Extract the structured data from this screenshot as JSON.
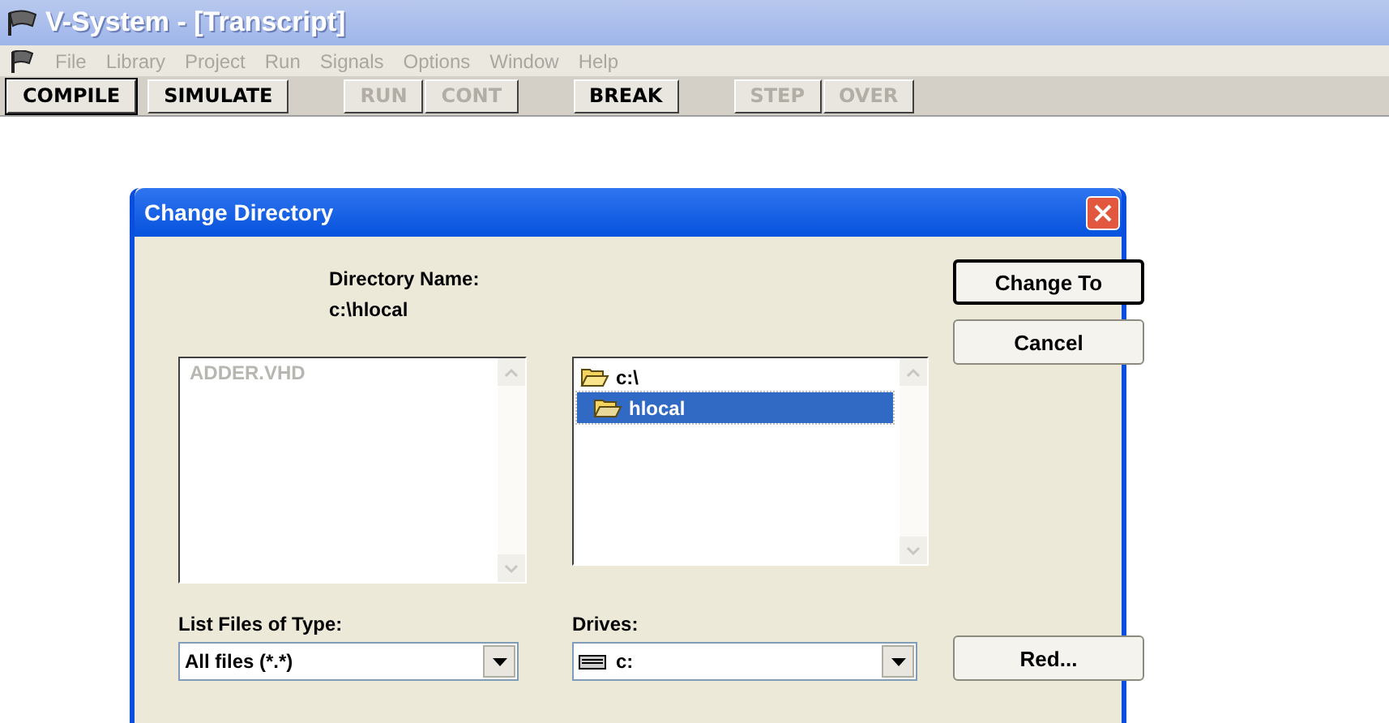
{
  "window": {
    "title": "V-System - [Transcript]"
  },
  "menu": [
    {
      "label": "File",
      "disabled": true
    },
    {
      "label": "Library",
      "disabled": true
    },
    {
      "label": "Project",
      "disabled": true
    },
    {
      "label": "Run",
      "disabled": true
    },
    {
      "label": "Signals",
      "disabled": true
    },
    {
      "label": "Options",
      "disabled": true
    },
    {
      "label": "Window",
      "disabled": true
    },
    {
      "label": "Help",
      "disabled": true
    }
  ],
  "toolbar": [
    [
      {
        "label": "COMPILE",
        "disabled": false,
        "pressed": true
      },
      {
        "label": "SIMULATE",
        "disabled": false,
        "pressed": false
      }
    ],
    [
      {
        "label": "RUN",
        "disabled": true,
        "pressed": false
      },
      {
        "label": "CONT",
        "disabled": true,
        "pressed": false
      }
    ],
    [
      {
        "label": "BREAK",
        "disabled": false,
        "pressed": false
      }
    ],
    [
      {
        "label": "STEP",
        "disabled": true,
        "pressed": false
      },
      {
        "label": "OVER",
        "disabled": true,
        "pressed": false
      }
    ]
  ],
  "dialog": {
    "title": "Change Directory",
    "directory_label": "Directory Name:",
    "directory_value": "c:\\hlocal",
    "files": [
      {
        "name": "ADDER.VHD",
        "disabled": true
      }
    ],
    "folders": [
      {
        "name": "c:\\",
        "selected": false,
        "kind": "open"
      },
      {
        "name": "hlocal",
        "selected": true,
        "kind": "open"
      }
    ],
    "type_label": "List Files of Type:",
    "type_value": "All files (*.*)",
    "drives_label": "Drives:",
    "drives_value": "c:",
    "buttons": [
      {
        "label": "Change To",
        "default": true
      },
      {
        "label": "Cancel",
        "default": false
      }
    ],
    "network_button": "Red..."
  }
}
